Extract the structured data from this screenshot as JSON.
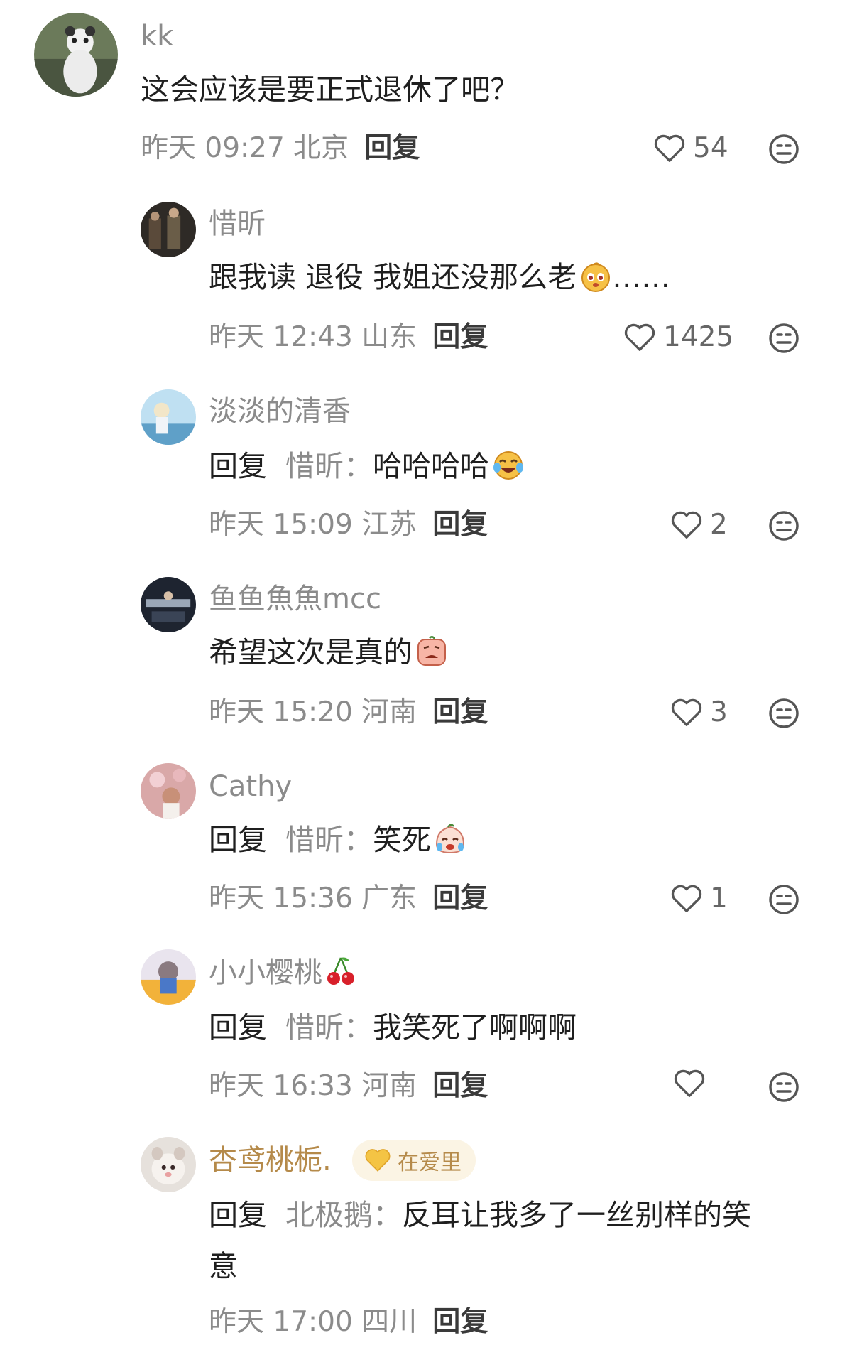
{
  "comments": [
    {
      "user": "kk",
      "text": "这会应该是要正式退休了吧？",
      "time_loc": "昨天 09:27 北京",
      "reply": "回复",
      "likes": "54"
    },
    {
      "user": "惜昕",
      "text": "跟我读 退役 我姐还没那么老",
      "text_tail": "……",
      "time_loc": "昨天 12:43 山东",
      "reply": "回复",
      "likes": "1425"
    },
    {
      "user": "淡淡的清香",
      "prefix": "回复",
      "target": "惜昕：",
      "text": "哈哈哈哈",
      "time_loc": "昨天 15:09 江苏",
      "reply": "回复",
      "likes": "2"
    },
    {
      "user": "鱼鱼魚魚mcc",
      "text": "希望这次是真的",
      "time_loc": "昨天 15:20 河南",
      "reply": "回复",
      "likes": "3"
    },
    {
      "user": "Cathy",
      "prefix": "回复",
      "target": "惜昕：",
      "text": "笑死",
      "time_loc": "昨天 15:36 广东",
      "reply": "回复",
      "likes": "1"
    },
    {
      "user": "小小樱桃",
      "prefix": "回复",
      "target": "惜昕：",
      "text": "我笑死了啊啊啊",
      "time_loc": "昨天 16:33 河南",
      "reply": "回复",
      "likes": ""
    },
    {
      "user": "杏鸢桃栀.",
      "badge": "在爱里",
      "prefix": "回复",
      "target": "北极鹅：",
      "text": "反耳让我多了一丝别样的笑",
      "text_line2": "意",
      "time_loc": "昨天 17:00 四川",
      "reply": "回复"
    }
  ],
  "icons": {
    "like": "heart-outline-icon",
    "dislike": "neutral-face-icon"
  },
  "colors": {
    "username": "#8b8b8b",
    "username_badge": "#b58a4a",
    "meta": "#8b8b8b",
    "badge_bg": "#fbf4e4"
  }
}
